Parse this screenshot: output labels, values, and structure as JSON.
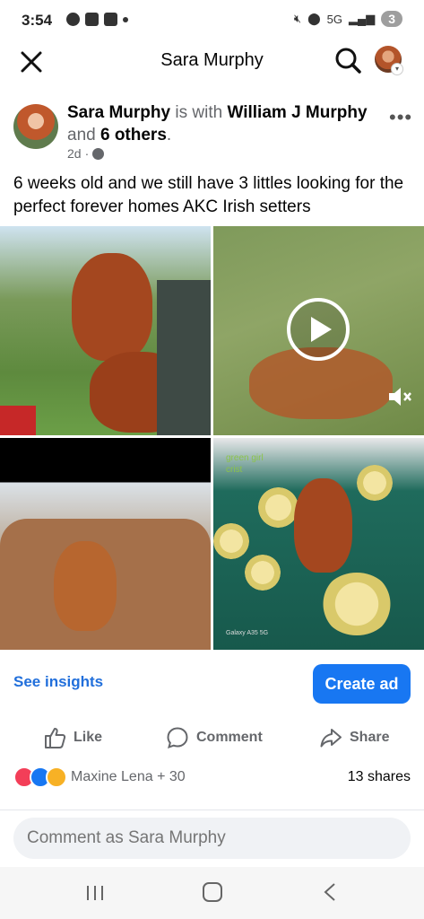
{
  "status_bar": {
    "time": "3:54",
    "network": "5G",
    "battery": "3",
    "icons": [
      "threads-icon",
      "alert-icon",
      "n-icon",
      "dot-icon",
      "mute-icon",
      "location-icon",
      "signal-icon"
    ]
  },
  "header": {
    "title": "Sara Murphy",
    "close_icon": "close-icon",
    "search_icon": "search-icon"
  },
  "post": {
    "author": "Sara Murphy",
    "with_text": "is with",
    "tagged": "William J Murphy",
    "and_text": "and",
    "others": "6 others",
    "time": "2d",
    "privacy": "globe-icon",
    "more": "•••",
    "caption": "6 weeks old and we still have 3 littles looking for the perfect forever homes AKC Irish setters",
    "photo4_overlay": "green girl\ncrist",
    "photo4_watermark": "Galaxy A35 5G"
  },
  "insights": {
    "see_insights": "See insights",
    "create_ad": "Create ad"
  },
  "actions": {
    "like": "Like",
    "comment": "Comment",
    "share": "Share"
  },
  "reactions": {
    "names": "Maxine Lena + 30",
    "shares": "13 shares",
    "colors": {
      "love": "#f33e58",
      "like": "#1877f2",
      "care": "#f7b125"
    }
  },
  "comment": {
    "placeholder": "Comment as Sara Murphy"
  },
  "colors": {
    "accent": "#1877f2",
    "link": "#216fdb"
  }
}
